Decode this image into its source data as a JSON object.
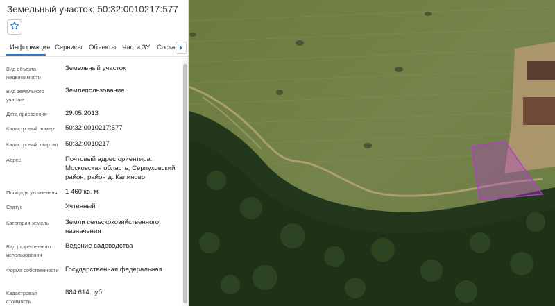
{
  "panel": {
    "title": "Земельный участок: 50:32:0010217:577",
    "favorite_icon": "star-icon",
    "tabs": [
      {
        "label": "Информация",
        "active": true
      },
      {
        "label": "Сервисы",
        "active": false
      },
      {
        "label": "Объекты",
        "active": false
      },
      {
        "label": "Части ЗУ",
        "active": false
      },
      {
        "label": "Состав",
        "active": false
      }
    ],
    "tabs_next_icon": "chevron-right-icon",
    "info": [
      {
        "label": "Вид объекта недвижимости",
        "value": "Земельный участок"
      },
      {
        "label": "Вид земельного участка",
        "value": "Землепользование"
      },
      {
        "label": "Дата присвоения",
        "value": "29.05.2013"
      },
      {
        "label": "Кадастровый номер",
        "value": "50:32:0010217:577"
      },
      {
        "label": "Кадастровый квартал",
        "value": "50:32:0010217"
      },
      {
        "label": "Адрес",
        "value": "Почтовый адрес ориентира: Московская область, Серпуховский район, район д. Калиново"
      },
      {
        "label": "Площадь уточненная",
        "value": "1 460 кв. м"
      },
      {
        "label": "Статус",
        "value": "Учтенный"
      },
      {
        "label": "Категория земель",
        "value": "Земли сельскохозяйственного назначения"
      },
      {
        "label": "Вид разрешенного использования",
        "value": "Ведение садоводства"
      },
      {
        "label": "Форма собственности",
        "value": "Государственная федеральная"
      },
      {
        "label": "Кадастровая стоимость",
        "value": "884 614 руб."
      }
    ]
  },
  "map": {
    "parcel_highlight_color": "#b23ad0"
  }
}
